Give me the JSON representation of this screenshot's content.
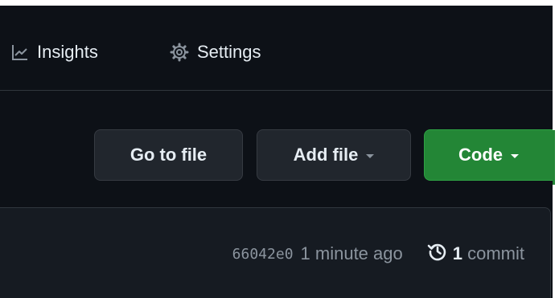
{
  "nav": {
    "insights_label": "Insights",
    "settings_label": "Settings"
  },
  "actions": {
    "go_to_file": "Go to file",
    "add_file": "Add file",
    "code": "Code"
  },
  "latest_commit": {
    "sha": "66042e0",
    "time": "1 minute ago",
    "count": "1",
    "count_word": "commit"
  },
  "icons": {
    "insights": "graph-icon",
    "settings": "gear-icon",
    "history": "history-icon"
  },
  "colors": {
    "background": "#0d1117",
    "border": "#30363d",
    "button_dark": "#21262d",
    "button_green": "#238636",
    "text": "#e6edf3",
    "muted": "#8b949e"
  }
}
